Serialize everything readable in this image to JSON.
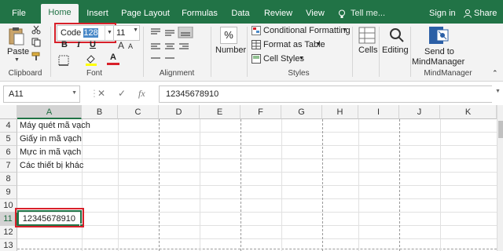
{
  "tabs": [
    "File",
    "Home",
    "Insert",
    "Page Layout",
    "Formulas",
    "Data",
    "Review",
    "View"
  ],
  "tell_me": "Tell me...",
  "sign_in": "Sign in",
  "share": "Share",
  "clipboard": {
    "paste": "Paste",
    "label": "Clipboard"
  },
  "font": {
    "name_prefix": "Code ",
    "name_selected": "128",
    "size": "11",
    "label": "Font",
    "bold": "B",
    "italic": "I",
    "underline": "U",
    "font_color_letter": "A"
  },
  "alignment": {
    "label": "Alignment"
  },
  "number": {
    "symbol": "%",
    "label": "Number"
  },
  "styles": {
    "conditional": "Conditional Formatting",
    "format_table": "Format as Table",
    "cell_styles": "Cell Styles",
    "label": "Styles"
  },
  "cells": {
    "label": "Cells"
  },
  "editing": {
    "label": "Editing"
  },
  "mindmanager": {
    "send_line1": "Send to",
    "send_line2": "MindManager",
    "label": "MindManager"
  },
  "formula_bar": {
    "name_box": "A11",
    "fx": "fx",
    "value": "12345678910"
  },
  "columns": [
    "A",
    "B",
    "C",
    "D",
    "E",
    "F",
    "G",
    "H",
    "I",
    "J",
    "K"
  ],
  "rows": [
    "4",
    "5",
    "6",
    "7",
    "8",
    "9",
    "10",
    "11",
    "12",
    "13"
  ],
  "cells_data": {
    "a4": "Máy quét mã vạch",
    "a5": "Giấy in mã vạch",
    "a6": "Mực in mã vạch",
    "a7": "Các thiết bị khác",
    "a11": "12345678910"
  },
  "colors": {
    "excel_green": "#217346",
    "highlight_red": "#d8202a",
    "selection_blue": "#4a89c8"
  }
}
